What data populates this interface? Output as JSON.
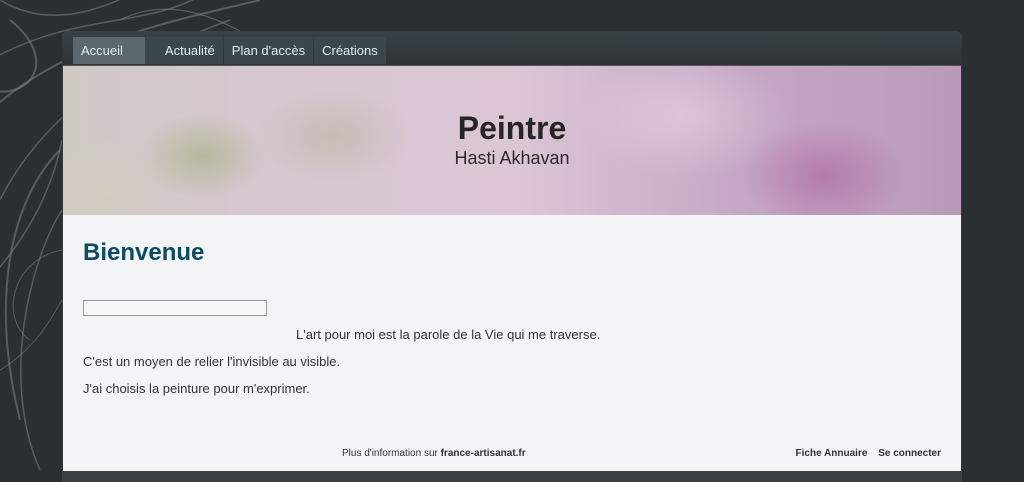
{
  "nav": {
    "items": [
      {
        "label": "Accueil",
        "active": true
      },
      {
        "label": "Actualité"
      },
      {
        "label": "Plan d'accès"
      },
      {
        "label": "Créations"
      }
    ]
  },
  "banner": {
    "title": "Peintre",
    "subtitle": "Hasti Akhavan"
  },
  "main": {
    "title": "Bienvenue",
    "paragraphs": [
      "L'art pour moi est la parole de la Vie qui me traverse.",
      "C'est un moyen de relier l'invisible au visible.",
      "J'ai choisis la peinture pour m'exprimer."
    ]
  },
  "footer": {
    "info_prefix": "Plus d'information sur",
    "info_link": "france-artisanat.fr",
    "links": [
      "Fiche Annuaire",
      "Se connecter"
    ]
  },
  "colors": {
    "background": "#2a2f33",
    "title": "#0d4a64",
    "content_bg": "#f3f4f6"
  }
}
